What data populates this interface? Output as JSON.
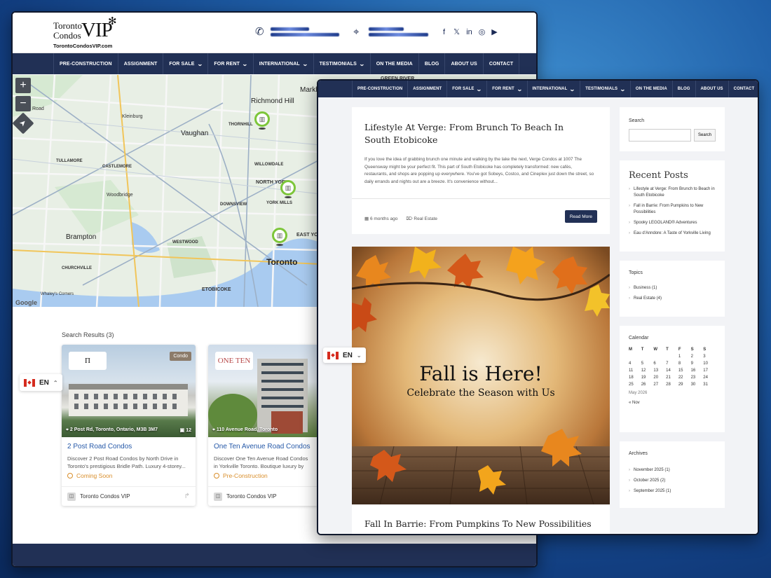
{
  "brand": {
    "name_line1": "Toronto",
    "name_line2": "Condos",
    "name_vip": "VIP",
    "url": "TorontoCondosVIP.com",
    "accent": "#213055",
    "leaf_icon": "maple-leaf-icon"
  },
  "nav_items": [
    {
      "label": "PRE-CONSTRUCTION",
      "has_menu": false
    },
    {
      "label": "ASSIGNMENT",
      "has_menu": false
    },
    {
      "label": "FOR SALE",
      "has_menu": true
    },
    {
      "label": "FOR RENT",
      "has_menu": true
    },
    {
      "label": "INTERNATIONAL",
      "has_menu": true
    },
    {
      "label": "TESTIMONIALS",
      "has_menu": true
    },
    {
      "label": "ON THE MEDIA",
      "has_menu": false
    },
    {
      "label": "BLOG",
      "has_menu": false
    },
    {
      "label": "ABOUT US",
      "has_menu": false
    },
    {
      "label": "CONTACT",
      "has_menu": false
    }
  ],
  "map": {
    "labels": {
      "richmond_hill": "Richmond Hill",
      "vaughan": "Vaughan",
      "toronto": "Toronto",
      "brampton": "Brampton",
      "north_york": "NORTH YORK",
      "east_york": "EAST YO",
      "etobicoke": "ETOBICOKE",
      "markham": "Markh",
      "green_river": "GREEN RIVER",
      "kleinburg": "Kleinburg",
      "woodbridge": "Woodbridge",
      "thornhill": "THORNHILL",
      "downsview": "DOWNSVIEW",
      "willowdale": "WILLOWDALE",
      "york_mills": "YORK MILLS",
      "castlemore": "CASTLEMORE",
      "tullamore": "TULLAMORE",
      "churchville": "CHURCHVILLE",
      "westwood": "WESTWOOD",
      "whaleys": "Whaley's Corners",
      "road": "Road",
      "google": "Google"
    },
    "controls": {
      "zoom_in": "+",
      "zoom_out": "−",
      "locate": "➤"
    }
  },
  "results": {
    "title": "Search Results (3)",
    "cards": [
      {
        "title": "2 Post Road Condos",
        "desc": "Discover 2 Post Road Condos by North Drive in Toronto's prestigious Bridle Path. Luxury 4-storey...",
        "status": "Coming Soon",
        "address": "2 Post Rd, Toronto, Ontario, M3B 3M7",
        "count": "12",
        "tag": "Condo",
        "brand": "Π",
        "agent": "Toronto Condos VIP"
      },
      {
        "title": "One Ten Avenue Road Condos",
        "desc": "Discover One Ten Avenue Road Condos in Yorkville Toronto. Boutique luxury by Sierra Building Gr...",
        "status": "Pre-Construction",
        "address": "110 Avenue Road, Toronto",
        "brand": "ONE TEN",
        "agent": "Toronto Condos VIP"
      }
    ]
  },
  "lang": {
    "code": "EN"
  },
  "blog": {
    "post1": {
      "title": "Lifestyle At Verge: From Brunch To Beach In South Etobicoke",
      "excerpt": "If you love the idea of grabbing brunch one minute and walking by the lake the next, Verge Condos at 1007 The Queensway might be your perfect fit. This part of South Etobicoke has completely transformed: new cafés, restaurants, and shops are popping up everywhere. You've got Sobeys, Costco, and Cineplex just down the street, so daily errands and nights out are a breeze. It's convenience without...",
      "time": "6 months ago",
      "category": "Real Estate",
      "read_more": "Read More"
    },
    "feature": {
      "title": "Fall is Here!",
      "subtitle": "Celebrate the Season with Us"
    },
    "post2": {
      "title": "Fall In Barrie: From Pumpkins To New Possibilities"
    }
  },
  "sidebar": {
    "search": {
      "label": "Search",
      "button": "Search"
    },
    "recent": {
      "title": "Recent Posts",
      "items": [
        "Lifestyle at Verge: From Brunch to Beach in South Etobicoke",
        "Fall in Barrie: From Pumpkins to New Possibilities",
        "Spooky LEGOLAND® Adventures",
        "Eau d'Anndore: A Taste of Yorkville Living"
      ]
    },
    "topics": {
      "title": "Topics",
      "items": [
        "Business (1)",
        "Real Estate (4)"
      ]
    },
    "calendar": {
      "title": "Calendar",
      "days": [
        "M",
        "T",
        "W",
        "T",
        "F",
        "S",
        "S"
      ],
      "cells": [
        "",
        "",
        "",
        "",
        "1",
        "2",
        "3",
        "4",
        "5",
        "6",
        "7",
        "8",
        "9",
        "10",
        "11",
        "12",
        "13",
        "14",
        "15",
        "16",
        "17",
        "18",
        "19",
        "20",
        "21",
        "22",
        "23",
        "24",
        "25",
        "26",
        "27",
        "28",
        "29",
        "30",
        "31"
      ],
      "month": "May 2026",
      "prev": "« Nov"
    },
    "archives": {
      "title": "Archives",
      "items": [
        "November 2025 (1)",
        "October 2025 (2)",
        "September 2025 (1)"
      ]
    }
  }
}
